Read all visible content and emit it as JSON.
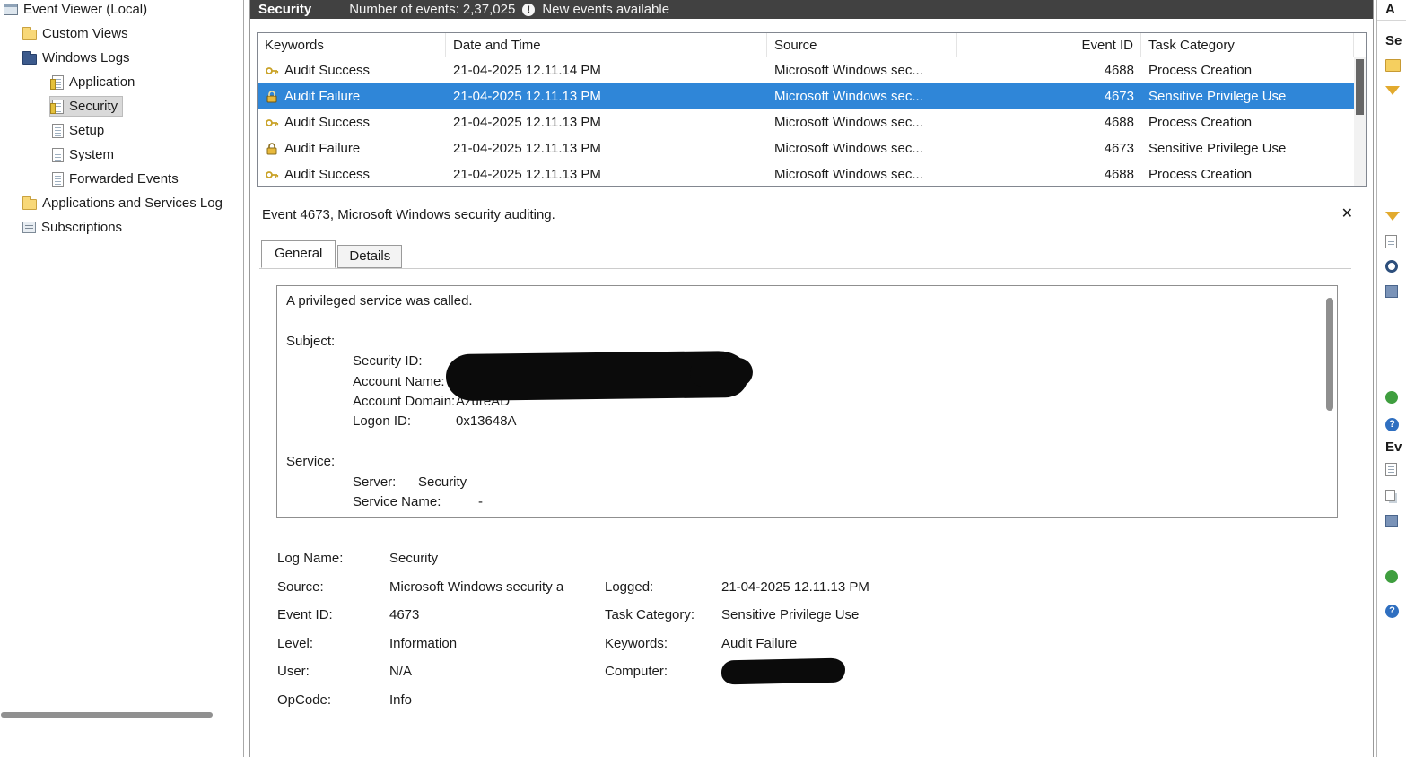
{
  "sidebar": {
    "items": [
      {
        "label": "Event Viewer (Local)",
        "level": 0,
        "icon": "event-viewer-icon",
        "selected": false
      },
      {
        "label": "Custom Views",
        "level": 1,
        "icon": "folder-icon",
        "selected": false
      },
      {
        "label": "Windows Logs",
        "level": 1,
        "icon": "folder-icon",
        "selected": false
      },
      {
        "label": "Application",
        "level": 2,
        "icon": "log-icon",
        "selected": false
      },
      {
        "label": "Security",
        "level": 2,
        "icon": "log-icon",
        "selected": true
      },
      {
        "label": "Setup",
        "level": 2,
        "icon": "log-icon",
        "selected": false
      },
      {
        "label": "System",
        "level": 2,
        "icon": "log-icon",
        "selected": false
      },
      {
        "label": "Forwarded Events",
        "level": 2,
        "icon": "log-icon",
        "selected": false
      },
      {
        "label": "Applications and Services Log",
        "level": 1,
        "icon": "folder-icon",
        "selected": false
      },
      {
        "label": "Subscriptions",
        "level": 1,
        "icon": "subscriptions-icon",
        "selected": false
      }
    ]
  },
  "log_header": {
    "title": "Security",
    "count_text": "Number of events: 2,37,025",
    "alert_glyph": "!",
    "alert_text": "New events available"
  },
  "event_table": {
    "columns": [
      "Keywords",
      "Date and Time",
      "Source",
      "Event ID",
      "Task Category"
    ],
    "rows": [
      {
        "keywords": "Audit Success",
        "icon": "key-icon",
        "date_time": "21-04-2025 12.11.14 PM",
        "source": "Microsoft Windows sec...",
        "event_id": "4688",
        "task_category": "Process Creation",
        "selected": false
      },
      {
        "keywords": "Audit Failure",
        "icon": "lock-icon",
        "date_time": "21-04-2025 12.11.13 PM",
        "source": "Microsoft Windows sec...",
        "event_id": "4673",
        "task_category": "Sensitive Privilege Use",
        "selected": true
      },
      {
        "keywords": "Audit Success",
        "icon": "key-icon",
        "date_time": "21-04-2025 12.11.13 PM",
        "source": "Microsoft Windows sec...",
        "event_id": "4688",
        "task_category": "Process Creation",
        "selected": false
      },
      {
        "keywords": "Audit Failure",
        "icon": "lock-icon",
        "date_time": "21-04-2025 12.11.13 PM",
        "source": "Microsoft Windows sec...",
        "event_id": "4673",
        "task_category": "Sensitive Privilege Use",
        "selected": false
      },
      {
        "keywords": "Audit Success",
        "icon": "key-icon",
        "date_time": "21-04-2025 12.11.13 PM",
        "source": "Microsoft Windows sec...",
        "event_id": "4688",
        "task_category": "Process Creation",
        "selected": false
      }
    ]
  },
  "event_detail": {
    "title": "Event 4673, Microsoft Windows security auditing.",
    "close_glyph": "✕",
    "tabs": [
      {
        "label": "General",
        "active": true
      },
      {
        "label": "Details",
        "active": false
      }
    ],
    "message": {
      "intro": "A privileged service was called.",
      "subject_header": "Subject:",
      "subject_fields": [
        {
          "label": "Security ID:",
          "value": "",
          "redacted": true
        },
        {
          "label": "Account Name:",
          "value": "",
          "redacted": true
        },
        {
          "label": "Account Domain:",
          "value": "AzureAD",
          "redacted": false
        },
        {
          "label": "Logon ID:",
          "value": "0x13648A",
          "redacted": false
        }
      ],
      "service_header": "Service:",
      "service_fields": [
        {
          "label": "Server:",
          "value": "Security"
        },
        {
          "label": "Service Name:",
          "value": "-"
        }
      ]
    },
    "properties_left": [
      {
        "label": "Log Name:",
        "value": "Security"
      },
      {
        "label": "Source:",
        "value": "Microsoft Windows security a"
      },
      {
        "label": "Event ID:",
        "value": "4673"
      },
      {
        "label": "Level:",
        "value": "Information"
      },
      {
        "label": "User:",
        "value": "N/A"
      },
      {
        "label": "OpCode:",
        "value": "Info"
      }
    ],
    "properties_right": [
      {
        "label": "Logged:",
        "value": "21-04-2025 12.11.13 PM"
      },
      {
        "label": "Task Category:",
        "value": "Sensitive Privilege Use"
      },
      {
        "label": "Keywords:",
        "value": "Audit Failure"
      },
      {
        "label": "Computer:",
        "value": "",
        "redacted": true
      }
    ]
  },
  "actions_panel": {
    "title": "A",
    "section_security": "Se",
    "section_event": "Ev",
    "icons": [
      "open-saved-log",
      "create-custom-view",
      "filter-current-log",
      "properties",
      "find",
      "save-all-events",
      "refresh",
      "help",
      "event-properties",
      "copy",
      "save-selected-events",
      "refresh-event",
      "help-event"
    ]
  },
  "colors": {
    "header_bg": "#414141",
    "selection_blue": "#2f86d8",
    "sidebar_selection": "#d9d9d9"
  }
}
